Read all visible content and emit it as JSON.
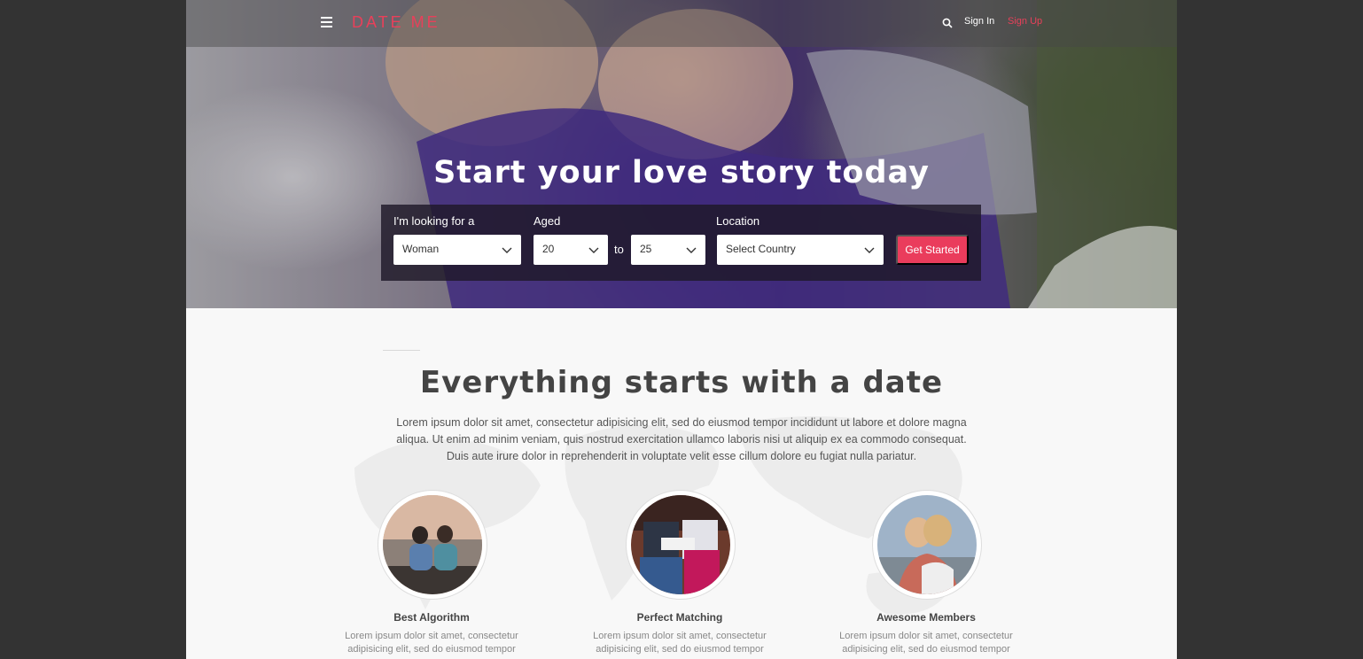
{
  "nav": {
    "logo": "DATE ME",
    "sign_in": "Sign In",
    "sign_up": "Sign Up",
    "icons": [
      "menu-icon",
      "search-icon"
    ]
  },
  "hero": {
    "title": "Start your love story today",
    "search": {
      "looking_for_label": "I'm looking for a",
      "looking_for_value": "Woman",
      "aged_label": "Aged",
      "age_from": "20",
      "to_label": "to",
      "age_to": "25",
      "location_label": "Location",
      "location_value": "Select Country",
      "submit_label": "Get Started"
    }
  },
  "intro": {
    "title": "Everything starts with a date",
    "text": "Lorem ipsum dolor sit amet, consectetur adipisicing elit, sed do eiusmod tempor incididunt ut labore et dolore magna aliqua. Ut enim ad minim veniam, quis nostrud exercitation ullamco laboris nisi ut aliquip ex ea commodo consequat. Duis aute irure dolor in reprehenderit in voluptate velit esse cillum dolore eu fugiat nulla pariatur."
  },
  "features": [
    {
      "title": "Best Algorithm",
      "text": "Lorem ipsum dolor sit amet, consectetur adipisicing elit, sed do eiusmod tempor"
    },
    {
      "title": "Perfect Matching",
      "text": "Lorem ipsum dolor sit amet, consectetur adipisicing elit, sed do eiusmod tempor"
    },
    {
      "title": "Awesome Members",
      "text": "Lorem ipsum dolor sit amet, consectetur adipisicing elit, sed do eiusmod tempor"
    }
  ],
  "colors": {
    "accent": "#ea3c5c",
    "outer_background": "#333333"
  }
}
